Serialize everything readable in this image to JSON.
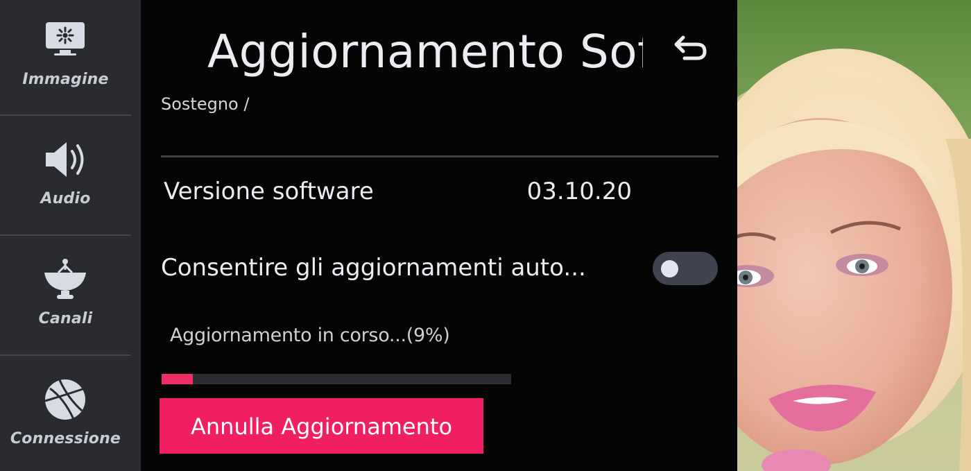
{
  "sidebar": {
    "items": [
      {
        "label": "Immagine",
        "icon": "picture-icon"
      },
      {
        "label": "Audio",
        "icon": "speaker-icon"
      },
      {
        "label": "Canali",
        "icon": "satellite-dish-icon"
      },
      {
        "label": "Connessione",
        "icon": "globe-icon"
      }
    ]
  },
  "panel": {
    "title": "Aggiornamento Software",
    "back_icon": "back-arrow-icon",
    "breadcrumb": "Sostegno /",
    "software_version": {
      "label": "Versione software",
      "value": "03.10.20"
    },
    "auto_update": {
      "label": "Consentire gli aggiornamenti auto...",
      "enabled": false
    },
    "update_status": "Aggiornamento in corso...(9%)",
    "progress": 0.09,
    "cancel_label": "Annulla Aggiornamento"
  },
  "colors": {
    "accent": "#f01f61",
    "sidebar_bg": "#2a2b2f",
    "panel_bg": "#050505",
    "text": "#ececf2"
  },
  "tv_preview": {
    "content": "live-tv-picture"
  }
}
